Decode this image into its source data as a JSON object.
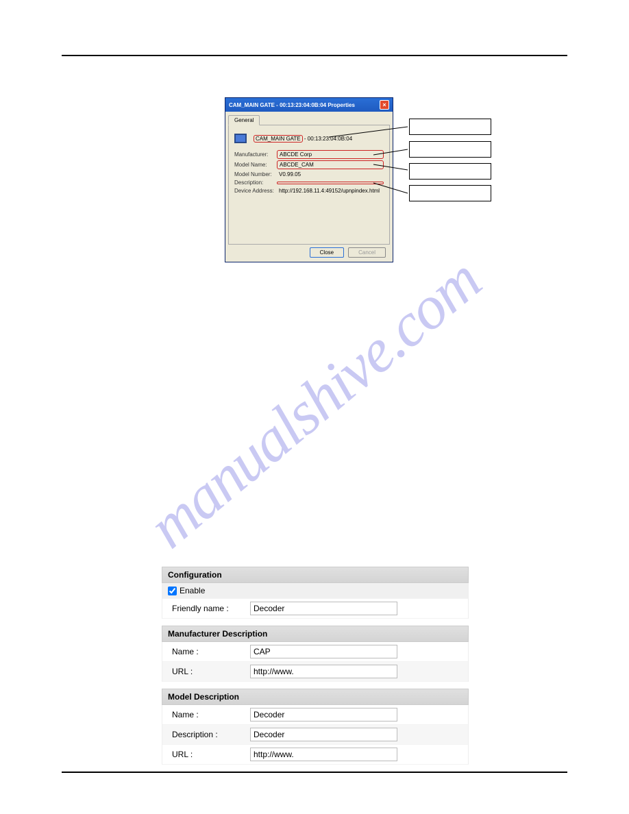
{
  "watermark": "manualshive.com",
  "dialog": {
    "title": "CAM_MAIN GATE - 00:13:23:04:0B:04 Properties",
    "tab_general": "General",
    "friendly_value": "CAM_MAIN GATE",
    "friendly_mac": "- 00:13:23:04:0B:04",
    "rows": {
      "manufacturer_label": "Manufacturer:",
      "manufacturer_value": "ABCDE Corp",
      "model_name_label": "Model Name:",
      "model_name_value": "ABCDE_CAM",
      "model_number_label": "Model Number:",
      "model_number_value": "V0.99.05",
      "description_label": "Description:",
      "description_value": "",
      "device_address_label": "Device Address:",
      "device_address_value": "http://192.168.11.4:49152/upnpindex.html"
    },
    "close_btn": "Close",
    "cancel_btn": "Cancel"
  },
  "callouts": {
    "c1": "",
    "c2": "",
    "c3": "",
    "c4": ""
  },
  "form": {
    "configuration": {
      "header": "Configuration",
      "enable_label": "Enable",
      "enable_checked": true,
      "friendly_name_label": "Friendly name :",
      "friendly_name_value": "Decoder"
    },
    "manufacturer": {
      "header": "Manufacturer Description",
      "name_label": "Name :",
      "name_value": "CAP",
      "url_label": "URL :",
      "url_value": "http://www."
    },
    "model": {
      "header": "Model Description",
      "name_label": "Name :",
      "name_value": "Decoder",
      "description_label": "Description :",
      "description_value": "Decoder",
      "url_label": "URL :",
      "url_value": "http://www."
    }
  }
}
